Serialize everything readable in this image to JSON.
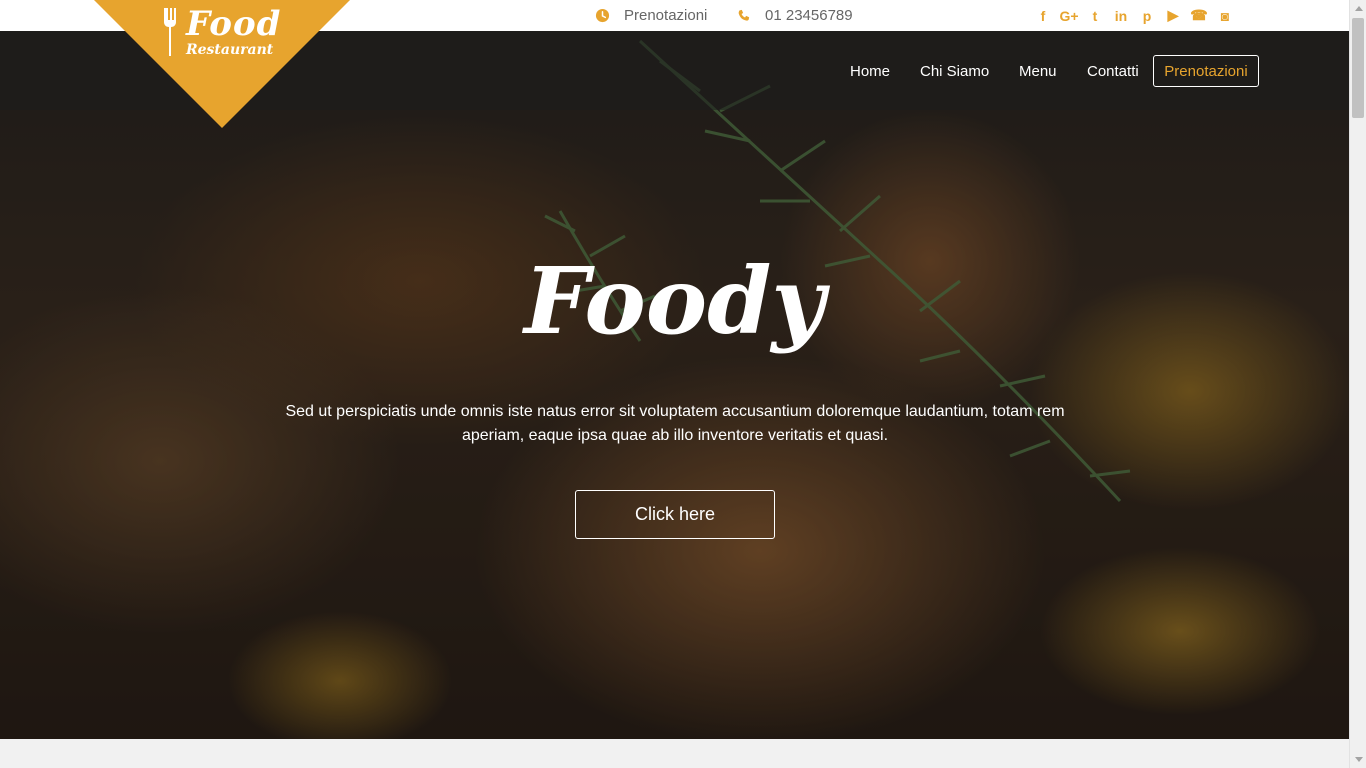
{
  "topbar": {
    "reservations_label": "Prenotazioni",
    "phone": "01 23456789",
    "reservations_icon": "clock-icon",
    "phone_icon": "phone-icon",
    "socials": [
      {
        "name": "facebook-icon",
        "glyph": "f"
      },
      {
        "name": "google-plus-icon",
        "glyph": "G+"
      },
      {
        "name": "twitter-icon",
        "glyph": "t"
      },
      {
        "name": "linkedin-icon",
        "glyph": "in"
      },
      {
        "name": "pinterest-icon",
        "glyph": "p"
      },
      {
        "name": "youtube-icon",
        "glyph": "▶"
      },
      {
        "name": "phone-icon",
        "glyph": "☎"
      },
      {
        "name": "camera-icon",
        "glyph": "◙"
      }
    ]
  },
  "logo": {
    "line1": "Food",
    "line2": "Restaurant",
    "icon": "fork-icon"
  },
  "nav": {
    "home": "Home",
    "about": "Chi Siamo",
    "menu": "Menu",
    "contacts": "Contatti",
    "reservations": "Prenotazioni"
  },
  "hero": {
    "title": "Foody",
    "text": "Sed ut perspiciatis unde omnis iste natus error sit voluptatem accusantium doloremque laudantium, totam rem aperiam, eaque ipsa quae ab illo inventore veritatis et quasi.",
    "button": "Click here"
  },
  "colors": {
    "accent": "#e7a42e",
    "topbar_bg": "#ffffff",
    "text_gray": "#666666"
  }
}
